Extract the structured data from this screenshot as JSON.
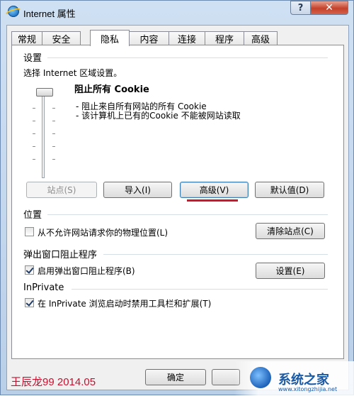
{
  "window": {
    "title": "Internet 属性",
    "help_glyph": "?",
    "close_glyph": "✕"
  },
  "tabs": [
    "常规",
    "安全",
    "隐私",
    "内容",
    "连接",
    "程序",
    "高级"
  ],
  "active_tab": "隐私",
  "settings": {
    "heading": "设置",
    "zone_prompt": "选择 Internet 区域设置。",
    "level_title": "阻止所有 Cookie",
    "descriptions": [
      "- 阻止来自所有网站的所有 Cookie",
      "- 该计算机上已有的Cookie 不能被网站读取"
    ],
    "slider_level": 1.0,
    "buttons": {
      "sites": "站点(S)",
      "import": "导入(I)",
      "advanced": "高级(V)",
      "default": "默认值(D)"
    }
  },
  "location": {
    "heading": "位置",
    "never_allow_label": "从不允许网站请求你的物理位置(L)",
    "never_allow_checked": false,
    "clear_sites_button": "清除站点(C)"
  },
  "popup": {
    "heading": "弹出窗口阻止程序",
    "enable_label": "启用弹出窗口阻止程序(B)",
    "enable_checked": true,
    "settings_button": "设置(E)"
  },
  "inprivate": {
    "heading": "InPrivate",
    "disable_label": "在 InPrivate 浏览启动时禁用工具栏和扩展(T)",
    "disable_checked": true
  },
  "footer": {
    "ok_button": "确定",
    "watermark": "王辰龙99 2014.05",
    "logo_text": "系统之家",
    "logo_url": "www.xitongzhijia.net"
  },
  "colors": {
    "highlight_underline": "#d0162b",
    "watermark": "#c8102e"
  }
}
